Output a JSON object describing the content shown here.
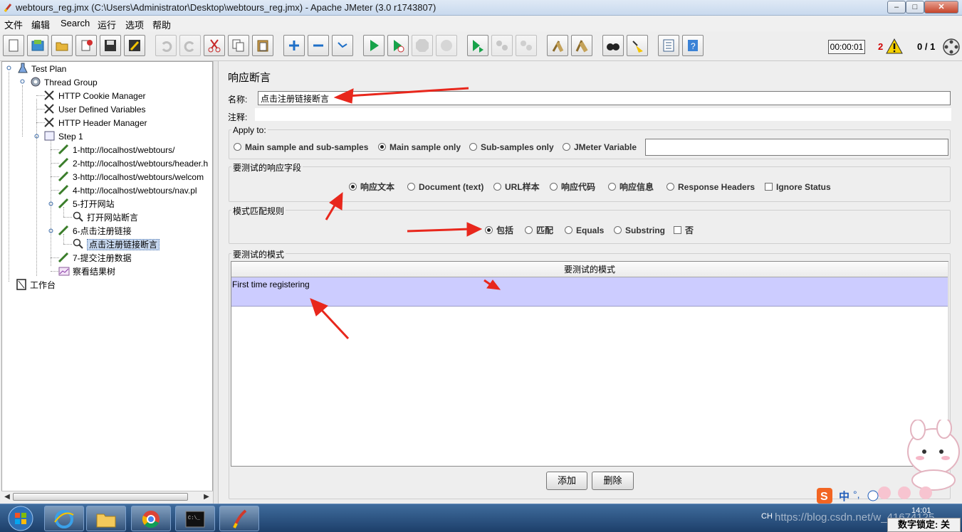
{
  "window": {
    "title": "webtours_reg.jmx (C:\\Users\\Administrator\\Desktop\\webtours_reg.jmx) - Apache JMeter (3.0 r1743807)",
    "min_label": "–",
    "max_label": "□",
    "close_label": "✕"
  },
  "menu": [
    "文件",
    "编辑",
    "Search",
    "运行",
    "选项",
    "帮助"
  ],
  "toolbar": {
    "timer": "00:00:01",
    "error_count": "2",
    "thread_count": "0 / 1",
    "buttons": [
      "new-icon",
      "templates-icon",
      "open-icon",
      "close-icon",
      "save-icon",
      "save-as-icon",
      "undo-icon",
      "redo-icon",
      "cut-icon",
      "copy-icon",
      "paste-icon",
      "expand-icon",
      "collapse-icon",
      "toggle-icon",
      "start-icon",
      "start-no-pause-icon",
      "stop-icon",
      "shutdown-icon",
      "remote-start-icon",
      "remote-stop-icon",
      "remote-shutdown-icon",
      "clear-icon",
      "clear-all-icon",
      "search-icon",
      "reset-search-icon",
      "function-helper-icon",
      "help-icon"
    ]
  },
  "tree": {
    "nodes": [
      {
        "label": "Test Plan"
      },
      {
        "label": "Thread Group"
      },
      {
        "label": "HTTP Cookie Manager"
      },
      {
        "label": "User Defined Variables"
      },
      {
        "label": "HTTP Header Manager"
      },
      {
        "label": "Step 1"
      },
      {
        "label": "1-http://localhost/webtours/"
      },
      {
        "label": "2-http://localhost/webtours/header.h"
      },
      {
        "label": "3-http://localhost/webtours/welcom"
      },
      {
        "label": "4-http://localhost/webtours/nav.pl"
      },
      {
        "label": "5-打开网站"
      },
      {
        "label": "打开网站断言"
      },
      {
        "label": "6-点击注册链接"
      },
      {
        "label": "点击注册链接断言"
      },
      {
        "label": "7-提交注册数据"
      },
      {
        "label": "察看结果树"
      },
      {
        "label": "工作台"
      }
    ]
  },
  "assertion": {
    "title": "响应断言",
    "name_label": "名称:",
    "name_value": "点击注册链接断言",
    "comment_label": "注释:",
    "comment_value": "",
    "apply_to": {
      "legend": "Apply to:",
      "options": [
        "Main sample and sub-samples",
        "Main sample only",
        "Sub-samples only",
        "JMeter Variable"
      ],
      "selected": "Main sample only",
      "variable_value": ""
    },
    "field_to_test": {
      "legend": "要测试的响应字段",
      "options": [
        "响应文本",
        "Document (text)",
        "URL样本",
        "响应代码",
        "响应信息",
        "Response Headers"
      ],
      "selected": "响应文本",
      "ignore_status": "Ignore Status"
    },
    "pattern_rules": {
      "legend": "模式匹配规则",
      "options": [
        "包括",
        "匹配",
        "Equals",
        "Substring"
      ],
      "selected": "包括",
      "not_label": "否"
    },
    "patterns": {
      "legend": "要测试的模式",
      "column": "要测试的模式",
      "rows": [
        "First time registering"
      ]
    },
    "add_button": "添加",
    "delete_button": "删除"
  },
  "taskbar": {
    "tray_lang": "CH",
    "clock": "14:01",
    "watermark": "https://blog.csdn.net/w_41674125",
    "num_lock": "数字锁定: 关",
    "ime_label": "中"
  },
  "colors": {
    "selection_row": "#ccccff",
    "annotation_arrow": "#e8271c"
  }
}
